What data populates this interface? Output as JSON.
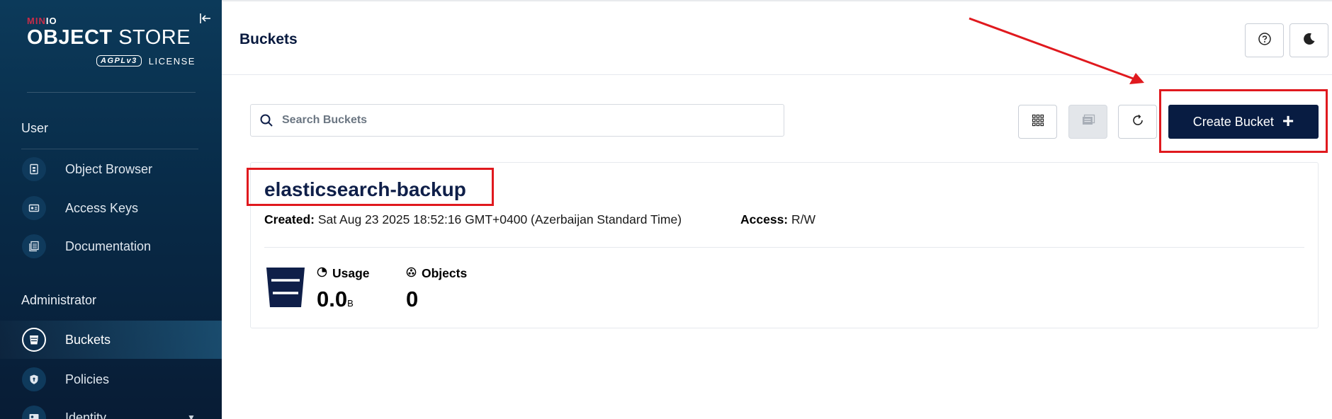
{
  "app": {
    "logo_brand": "MIN",
    "logo_brand_io": "IO",
    "logo_title_bold": "OBJECT",
    "logo_title_light": "STORE",
    "logo_badge": "AGPLv3",
    "logo_license": "LICENSE"
  },
  "sidebar": {
    "sections": [
      {
        "label": "User"
      },
      {
        "label": "Administrator"
      }
    ],
    "items": [
      {
        "label": "Object Browser",
        "icon": "object-browser-icon",
        "active": false
      },
      {
        "label": "Access Keys",
        "icon": "access-keys-icon",
        "active": false
      },
      {
        "label": "Documentation",
        "icon": "documentation-icon",
        "active": false
      },
      {
        "label": "Buckets",
        "icon": "bucket-icon",
        "active": true
      },
      {
        "label": "Policies",
        "icon": "policy-icon",
        "active": false
      },
      {
        "label": "Identity",
        "icon": "identity-icon",
        "active": false
      }
    ]
  },
  "header": {
    "title": "Buckets",
    "help_icon": "help-icon",
    "theme_icon": "moon-icon"
  },
  "toolbar": {
    "search_placeholder": "Search Buckets",
    "search_value": "",
    "create_label": "Create Bucket",
    "create_icon": "plus-icon"
  },
  "bucket": {
    "name": "elasticsearch-backup",
    "created_label": "Created:",
    "created_value": "Sat Aug 23 2025 18:52:16 GMT+0400 (Azerbaijan Standard Time)",
    "access_label": "Access:",
    "access_value": "R/W",
    "usage_label": "Usage",
    "usage_value": "0.0",
    "usage_unit": "B",
    "objects_label": "Objects",
    "objects_value": "0"
  },
  "colors": {
    "sidebar_top": "#0c3a5a",
    "sidebar_bottom": "#081c35",
    "brand_navy": "#081c42",
    "minio_red": "#c72c48",
    "annotation_red": "#e0191e"
  }
}
